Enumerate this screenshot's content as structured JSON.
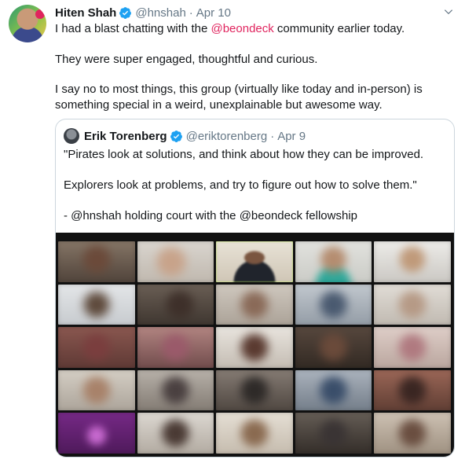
{
  "tweet": {
    "author_name": "Hiten Shah",
    "author_handle": "@hnshah",
    "date": "Apr 10",
    "line1_before": "I had a blast chatting with the ",
    "line1_mention": "@beondeck",
    "line1_after": " community earlier today.",
    "paragraph2": "They were super engaged, thoughtful and curious.",
    "paragraph3": "I say no to most things, this group (virtually like today and in-person) is something special in a weird, unexplainable but awesome way."
  },
  "quoted_tweet": {
    "author_name": "Erik Torenberg",
    "author_handle": "@eriktorenberg",
    "date": "Apr 9",
    "paragraph1": "\"Pirates look at solutions, and think about how they can be improved.",
    "paragraph2": "Explorers look at problems, and try to figure out how to solve them.\"",
    "paragraph3": "- @hnshah holding court with the @beondeck fellowship"
  },
  "colors": {
    "mention": "#e0245e",
    "verified": "#1da1f2",
    "muted": "#657786",
    "border": "#ccd6dd"
  },
  "icons": {
    "verified": "verified-badge-icon",
    "caret": "chevron-down-icon"
  }
}
